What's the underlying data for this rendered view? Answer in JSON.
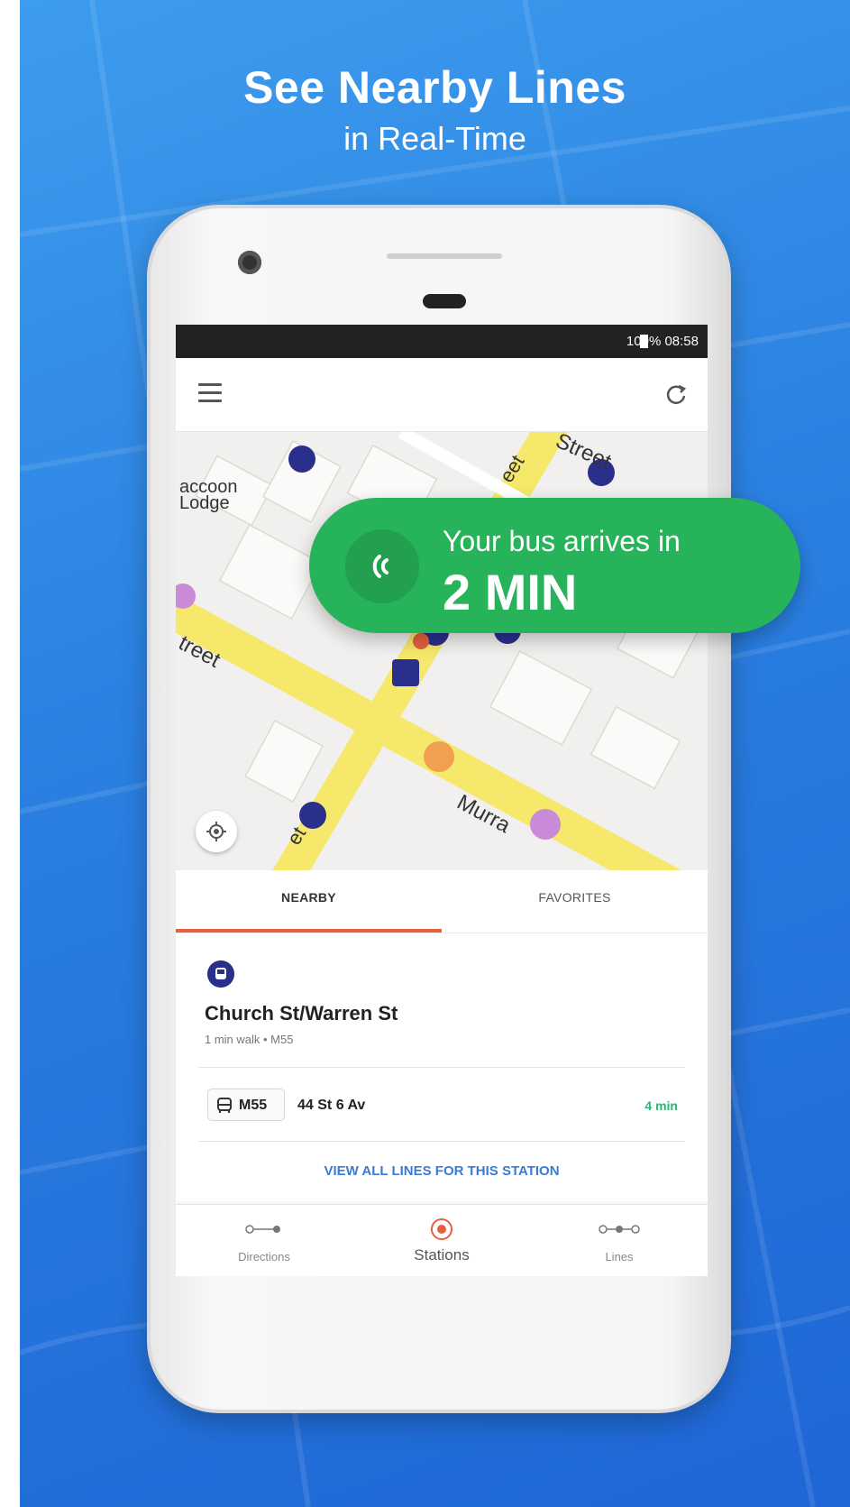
{
  "promo": {
    "title": "See Nearby Lines",
    "subtitle": "in Real-Time"
  },
  "status_bar": {
    "text": "100%  08:58"
  },
  "app_bar": {
    "menu_icon": "menu-icon",
    "refresh_icon": "refresh-icon"
  },
  "map": {
    "labels": [
      "accoon",
      "Lodge",
      "Street",
      "treet",
      "eet",
      "Murra",
      "et"
    ]
  },
  "notification": {
    "line1": "Your bus arrives in",
    "line2": "2 MIN"
  },
  "tabs": [
    {
      "label": "NEARBY",
      "active": true
    },
    {
      "label": "FAVORITES",
      "active": false
    }
  ],
  "station": {
    "name": "Church St/Warren St",
    "meta": "1 min walk • M55",
    "line": {
      "code": "M55",
      "destination": "44 St 6 Av",
      "eta": "4 min"
    },
    "view_all": "VIEW ALL LINES FOR THIS STATION"
  },
  "bottom_nav": [
    {
      "label": "Directions",
      "icon": "directions-icon",
      "active": false
    },
    {
      "label": "Stations",
      "icon": "stations-icon",
      "active": true
    },
    {
      "label": "Lines",
      "icon": "lines-icon",
      "active": false
    }
  ],
  "colors": {
    "background": "#2a7fe0",
    "notification": "#27b35a",
    "accent": "#e8603c",
    "bus_icon": "#2b2f8c",
    "eta": "#2bb673",
    "link": "#3a7bd5"
  }
}
